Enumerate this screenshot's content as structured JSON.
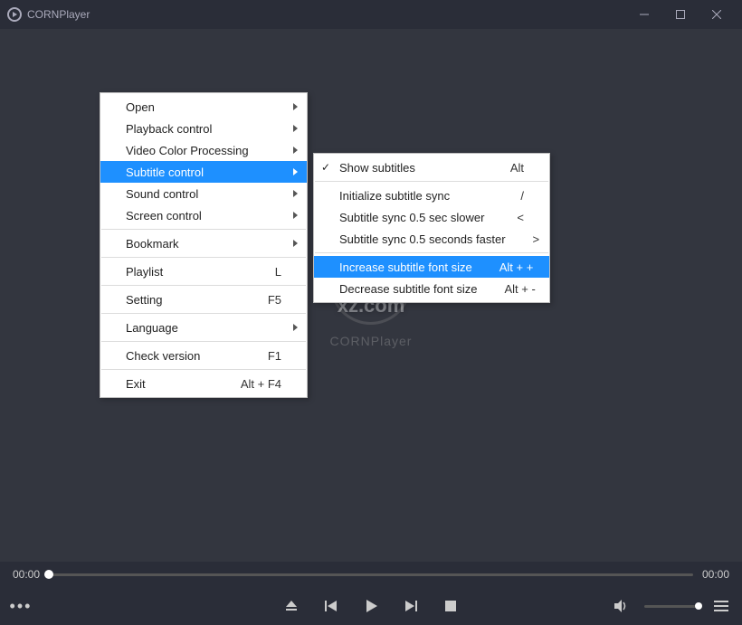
{
  "title": "CORNPlayer",
  "center_brand": "CORNPlayer",
  "watermark": "xz.com",
  "time_current": "00:00",
  "time_total": "00:00",
  "menu_main": [
    {
      "label": "Open",
      "shortcut": "",
      "sub": true
    },
    {
      "label": "Playback control",
      "shortcut": "",
      "sub": true
    },
    {
      "label": "Video Color Processing",
      "shortcut": "",
      "sub": true
    },
    {
      "label": "Subtitle control",
      "shortcut": "",
      "sub": true,
      "highlight": true
    },
    {
      "label": "Sound control",
      "shortcut": "",
      "sub": true
    },
    {
      "label": "Screen control",
      "shortcut": "",
      "sub": true
    },
    {
      "sep": true
    },
    {
      "label": "Bookmark",
      "shortcut": "",
      "sub": true
    },
    {
      "sep": true
    },
    {
      "label": "Playlist",
      "shortcut": "L"
    },
    {
      "sep": true
    },
    {
      "label": "Setting",
      "shortcut": "F5"
    },
    {
      "sep": true
    },
    {
      "label": "Language",
      "shortcut": "",
      "sub": true
    },
    {
      "sep": true
    },
    {
      "label": "Check version",
      "shortcut": "F1"
    },
    {
      "sep": true
    },
    {
      "label": "Exit",
      "shortcut": "Alt + F4"
    }
  ],
  "menu_sub": [
    {
      "label": "Show subtitles",
      "shortcut": "Alt",
      "checked": true
    },
    {
      "sep": true
    },
    {
      "label": "Initialize subtitle sync",
      "shortcut": "/"
    },
    {
      "label": "Subtitle sync 0.5 sec slower",
      "shortcut": "<"
    },
    {
      "label": "Subtitle sync 0.5 seconds faster",
      "shortcut": ">"
    },
    {
      "sep": true
    },
    {
      "label": "Increase subtitle font size",
      "shortcut": "Alt + +",
      "highlight": true
    },
    {
      "label": "Decrease subtitle font size",
      "shortcut": "Alt + -"
    }
  ],
  "icons": {
    "minimize": "minimize-icon",
    "maximize": "maximize-icon",
    "close": "close-icon",
    "more": "more-icon",
    "eject": "eject-icon",
    "prev": "prev-icon",
    "play": "play-icon",
    "next": "next-icon",
    "stop": "stop-icon",
    "volume": "volume-icon",
    "menu": "menu-icon"
  }
}
